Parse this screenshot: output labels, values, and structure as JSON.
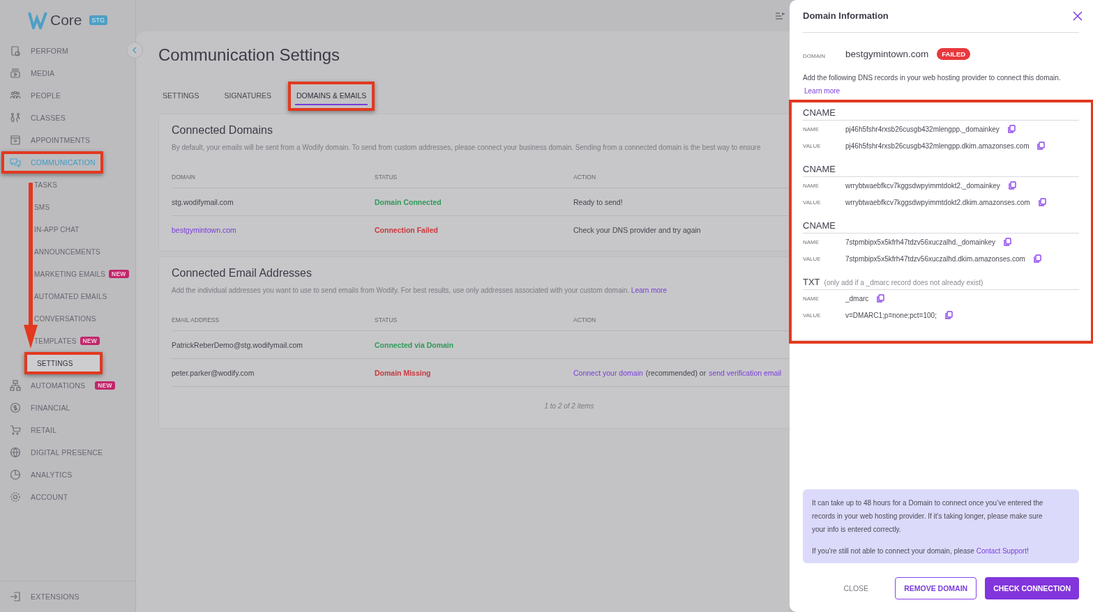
{
  "app": {
    "logo_text": "Core",
    "env_badge": "STG"
  },
  "sidebar": {
    "items": [
      {
        "label": "PERFORM",
        "selected": false,
        "highlighted": false
      },
      {
        "label": "MEDIA",
        "selected": false,
        "highlighted": false
      },
      {
        "label": "PEOPLE",
        "selected": false,
        "highlighted": false
      },
      {
        "label": "CLASSES",
        "selected": false,
        "highlighted": false
      },
      {
        "label": "APPOINTMENTS",
        "selected": false,
        "highlighted": false
      },
      {
        "label": "COMMUNICATION",
        "selected": true,
        "highlighted": true,
        "children": [
          {
            "label": "TASKS",
            "selected": false,
            "highlighted": false
          },
          {
            "label": "SMS",
            "selected": false,
            "highlighted": false
          },
          {
            "label": "IN-APP CHAT",
            "selected": false,
            "highlighted": false
          },
          {
            "label": "ANNOUNCEMENTS",
            "selected": false,
            "highlighted": false
          },
          {
            "label": "MARKETING EMAILS",
            "badge": "NEW",
            "selected": false,
            "highlighted": false
          },
          {
            "label": "AUTOMATED EMAILS",
            "selected": false,
            "highlighted": false
          },
          {
            "label": "CONVERSATIONS",
            "selected": false,
            "highlighted": false
          },
          {
            "label": "TEMPLATES",
            "badge": "NEW",
            "selected": false,
            "highlighted": false
          },
          {
            "label": "SETTINGS",
            "selected": true,
            "highlighted": true
          }
        ]
      },
      {
        "label": "AUTOMATIONS",
        "badge": "NEW",
        "selected": false,
        "highlighted": false
      },
      {
        "label": "FINANCIAL",
        "selected": false,
        "highlighted": false
      },
      {
        "label": "RETAIL",
        "selected": false,
        "highlighted": false
      },
      {
        "label": "DIGITAL PRESENCE",
        "selected": false,
        "highlighted": false
      },
      {
        "label": "ANALYTICS",
        "selected": false,
        "highlighted": false
      },
      {
        "label": "ACCOUNT",
        "selected": false,
        "highlighted": false
      }
    ],
    "footer_item": {
      "label": "EXTENSIONS"
    }
  },
  "annotations": [
    {
      "kind": "arrow"
    }
  ],
  "page": {
    "title": "Communication Settings",
    "tabs": [
      {
        "label": "SETTINGS",
        "selected": false,
        "highlighted": false
      },
      {
        "label": "SIGNATURES",
        "selected": false,
        "highlighted": false
      },
      {
        "label": "DOMAINS & EMAILS",
        "selected": true,
        "highlighted": true
      }
    ],
    "domains_card": {
      "title": "Connected Domains",
      "description": "By default, your emails will be sent from a Wodify domain. To send from custom addresses, please connect your business domain. Sending from a connected domain is the best way to ensure",
      "columns": [
        "DOMAIN",
        "STATUS",
        "ACTION"
      ],
      "rows": [
        {
          "domain": "stg.wodifymail.com",
          "link": false,
          "status": "Domain Connected",
          "kind": "success",
          "action": "Ready to send!"
        },
        {
          "domain": "bestgymintown.com",
          "link": true,
          "status": "Connection Failed",
          "kind": "error",
          "action": "Check your DNS provider and try again"
        }
      ]
    },
    "emails_card": {
      "title": "Connected Email Addresses",
      "description": "Add the individual addresses you want to use to send emails from Wodify. For best results, use only addresses associated with your custom domain.",
      "learn_more": "Learn more",
      "columns": [
        "EMAIL ADDRESS",
        "STATUS",
        "ACTION"
      ],
      "rows": [
        {
          "email": "PatrickReberDemo@stg.wodifymail.com",
          "status": "Connected via Domain",
          "kind": "success",
          "action": []
        },
        {
          "email": "peter.parker@wodify.com",
          "status": "Domain Missing",
          "kind": "error",
          "action": [
            {
              "text": "Connect your domain",
              "link": true
            },
            {
              "text": "(recommended) or",
              "link": false
            },
            {
              "text": "send verification email",
              "link": true
            }
          ]
        }
      ],
      "pagination": "1 to 2 of 2 items"
    }
  },
  "drawer": {
    "title": "Domain Information",
    "domain_label": "DOMAIN",
    "domain": "bestgymintown.com",
    "status_badge": "FAILED",
    "description": "Add the following DNS records in your web hosting provider to connect this domain.",
    "learn_more": "Learn more",
    "records_highlighted": true,
    "records": [
      {
        "type": "CNAME",
        "fields": [
          {
            "label": "NAME",
            "value": "pj46h5fshr4rxsb26cusgb432mlengpp._domainkey"
          },
          {
            "label": "VALUE",
            "value": "pj46h5fshr4rxsb26cusgb432mlengpp.dkim.amazonses.com"
          }
        ]
      },
      {
        "type": "CNAME",
        "fields": [
          {
            "label": "NAME",
            "value": "wrrybtwaebfkcv7kggsdwpyimmtdokt2._domainkey"
          },
          {
            "label": "VALUE",
            "value": "wrrybtwaebfkcv7kggsdwpyimmtdokt2.dkim.amazonses.com"
          }
        ]
      },
      {
        "type": "CNAME",
        "fields": [
          {
            "label": "NAME",
            "value": "7stpmbipx5x5kfrh47tdzv56xuczalhd._domainkey"
          },
          {
            "label": "VALUE",
            "value": "7stpmbipx5x5kfrh47tdzv56xuczalhd.dkim.amazonses.com"
          }
        ]
      },
      {
        "type": "TXT",
        "note": "(only add if a _dmarc record does not already exist)",
        "fields": [
          {
            "label": "NAME",
            "value": "_dmarc"
          },
          {
            "label": "VALUE",
            "value": "v=DMARC1;p=none;pct=100;"
          }
        ]
      }
    ],
    "info": {
      "paragraph": "It can take up to 48 hours for a Domain to connect once you’ve entered the records in your web hosting provider. If it’s taking longer, please make sure your info is entered correctly.",
      "support_text": "If you’re still not able to connect your domain, please",
      "support_link": "Contact Support",
      "support_end": "!"
    },
    "buttons": [
      {
        "label": "CLOSE",
        "kind": "text"
      },
      {
        "label": "REMOVE DOMAIN",
        "kind": "outline"
      },
      {
        "label": "CHECK CONNECTION",
        "kind": "primary"
      }
    ]
  }
}
